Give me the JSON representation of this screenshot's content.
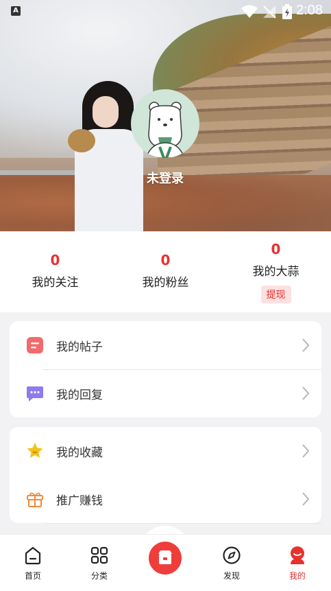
{
  "status_bar": {
    "time": "2:08",
    "notification_icon": "A"
  },
  "profile": {
    "name": "未登录"
  },
  "stats": [
    {
      "count": "0",
      "label": "我的关注"
    },
    {
      "count": "0",
      "label": "我的粉丝"
    },
    {
      "count": "0",
      "label": "我的大蒜",
      "action": "提现"
    }
  ],
  "menu_group_1": [
    {
      "label": "我的帖子",
      "icon": "posts-icon"
    },
    {
      "label": "我的回复",
      "icon": "reply-icon"
    }
  ],
  "menu_group_2": [
    {
      "label": "我的收藏",
      "icon": "star-icon"
    },
    {
      "label": "推广赚钱",
      "icon": "gift-icon"
    }
  ],
  "bottom_nav": [
    {
      "label": "首页",
      "icon": "home-icon"
    },
    {
      "label": "分类",
      "icon": "grid-icon"
    },
    {
      "label": "",
      "icon": "store-icon"
    },
    {
      "label": "发现",
      "icon": "compass-icon"
    },
    {
      "label": "我的",
      "icon": "profile-icon",
      "active": true
    }
  ],
  "colors": {
    "accent": "#e8312f",
    "background": "#f2f2f4"
  }
}
